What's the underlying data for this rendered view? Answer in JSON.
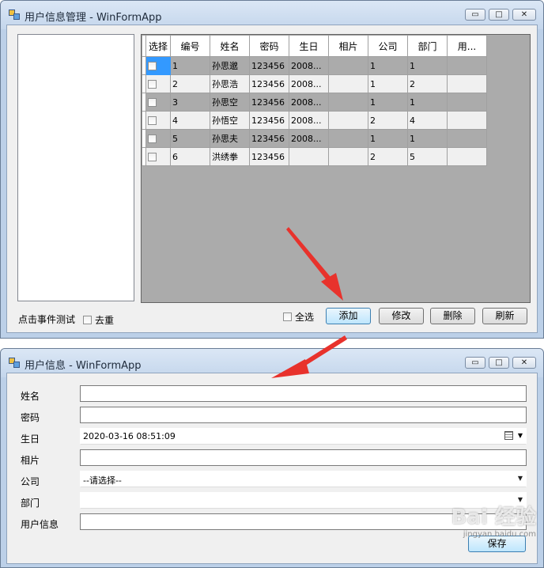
{
  "main_window": {
    "title": "用户信息管理 - WinFormApp",
    "controls": {
      "minimize": "▭",
      "maximize": "□",
      "close": "✕"
    },
    "grid": {
      "columns": [
        "选择",
        "编号",
        "姓名",
        "密码",
        "生日",
        "相片",
        "公司",
        "部门",
        "用..."
      ],
      "rows": [
        {
          "id": "1",
          "name": "孙思邈",
          "pwd": "123456",
          "birthday": "2008...",
          "photo": "",
          "company": "1",
          "dept": "1",
          "info": ""
        },
        {
          "id": "2",
          "name": "孙思浩",
          "pwd": "123456",
          "birthday": "2008...",
          "photo": "",
          "company": "1",
          "dept": "2",
          "info": ""
        },
        {
          "id": "3",
          "name": "孙思空",
          "pwd": "123456",
          "birthday": "2008...",
          "photo": "",
          "company": "1",
          "dept": "1",
          "info": ""
        },
        {
          "id": "4",
          "name": "孙悟空",
          "pwd": "123456",
          "birthday": "2008...",
          "photo": "",
          "company": "2",
          "dept": "4",
          "info": ""
        },
        {
          "id": "5",
          "name": "孙思夫",
          "pwd": "123456",
          "birthday": "2008...",
          "photo": "",
          "company": "1",
          "dept": "1",
          "info": ""
        },
        {
          "id": "6",
          "name": "洪绣拳",
          "pwd": "123456",
          "birthday": "",
          "photo": "",
          "company": "2",
          "dept": "5",
          "info": ""
        }
      ]
    },
    "footer": {
      "event_label": "点击事件测试",
      "dedupe_label": "去重",
      "select_all_label": "全选",
      "add": "添加",
      "edit": "修改",
      "delete": "删除",
      "refresh": "刷新"
    }
  },
  "form_window": {
    "title": "用户信息 - WinFormApp",
    "controls": {
      "minimize": "▭",
      "maximize": "□",
      "close": "✕"
    },
    "fields": {
      "name_label": "姓名",
      "password_label": "密码",
      "birthday_label": "生日",
      "birthday_value": "2020-03-16  08:51:09",
      "photo_label": "相片",
      "company_label": "公司",
      "company_value": "--请选择--",
      "dept_label": "部门",
      "info_label": "用户信息"
    },
    "save": "保存"
  },
  "watermark": {
    "brand": "Bai 经验",
    "url": "jingyan.baidu.com"
  },
  "colors": {
    "selection": "#3399ff",
    "arrow": "#e8322c",
    "grid_background": "#ababab"
  }
}
